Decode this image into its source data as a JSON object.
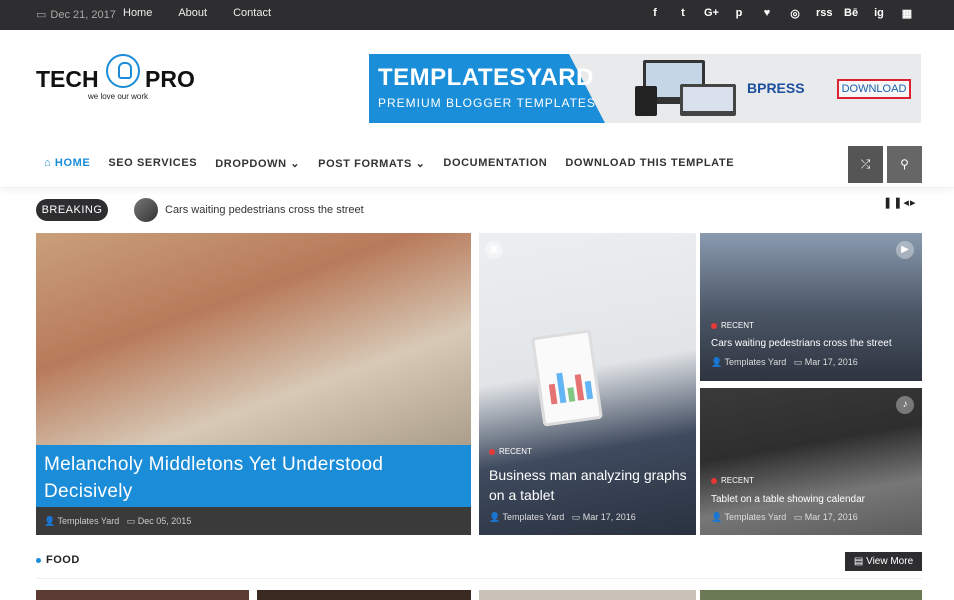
{
  "topbar": {
    "date": "Dec 21, 2017",
    "links": [
      "Home",
      "About",
      "Contact"
    ],
    "social": [
      "f",
      "t",
      "G+",
      "p",
      "♥",
      "◎",
      "rss",
      "Bē",
      "ig",
      "▦"
    ]
  },
  "logo": {
    "word1": "TECH",
    "word2": "PRO",
    "tagline": "we love our work"
  },
  "banner": {
    "title": "TEMPLATESYARD",
    "subtitle": "PREMIUM BLOGGER TEMPLATES",
    "brand": "BPRESS",
    "download": "DOWNLOAD"
  },
  "nav": {
    "items": [
      "HOME",
      "SEO SERVICES",
      "DROPDOWN",
      "POST FORMATS",
      "DOCUMENTATION",
      "DOWNLOAD THIS TEMPLATE"
    ],
    "home_icon": "home-icon",
    "dropdown_icon": "chevron-down-icon"
  },
  "breaking": {
    "label": "BREAKING",
    "text": "Cars waiting pedestrians cross the street",
    "controls": "❚❚◂▸"
  },
  "featured": [
    {
      "title": "Melancholy Middletons Yet Understood Decisively",
      "author": "Templates Yard",
      "date": "Dec 05, 2015"
    },
    {
      "category": "RECENT",
      "title": "Business man analyzing graphs on a tablet",
      "author": "Templates Yard",
      "date": "Mar 17, 2016"
    },
    {
      "category": "RECENT",
      "title": "Cars waiting pedestrians cross the street",
      "author": "Templates Yard",
      "date": "Mar 17, 2016"
    },
    {
      "category": "RECENT",
      "title": "Tablet on a table showing calendar",
      "author": "Templates Yard",
      "date": "Mar 17, 2016"
    }
  ],
  "section": {
    "title": "FOOD",
    "view_more": "View More"
  },
  "colors": {
    "accent": "#1a8cd8",
    "dark": "#2e2e30",
    "category_dot": "#e53935"
  }
}
